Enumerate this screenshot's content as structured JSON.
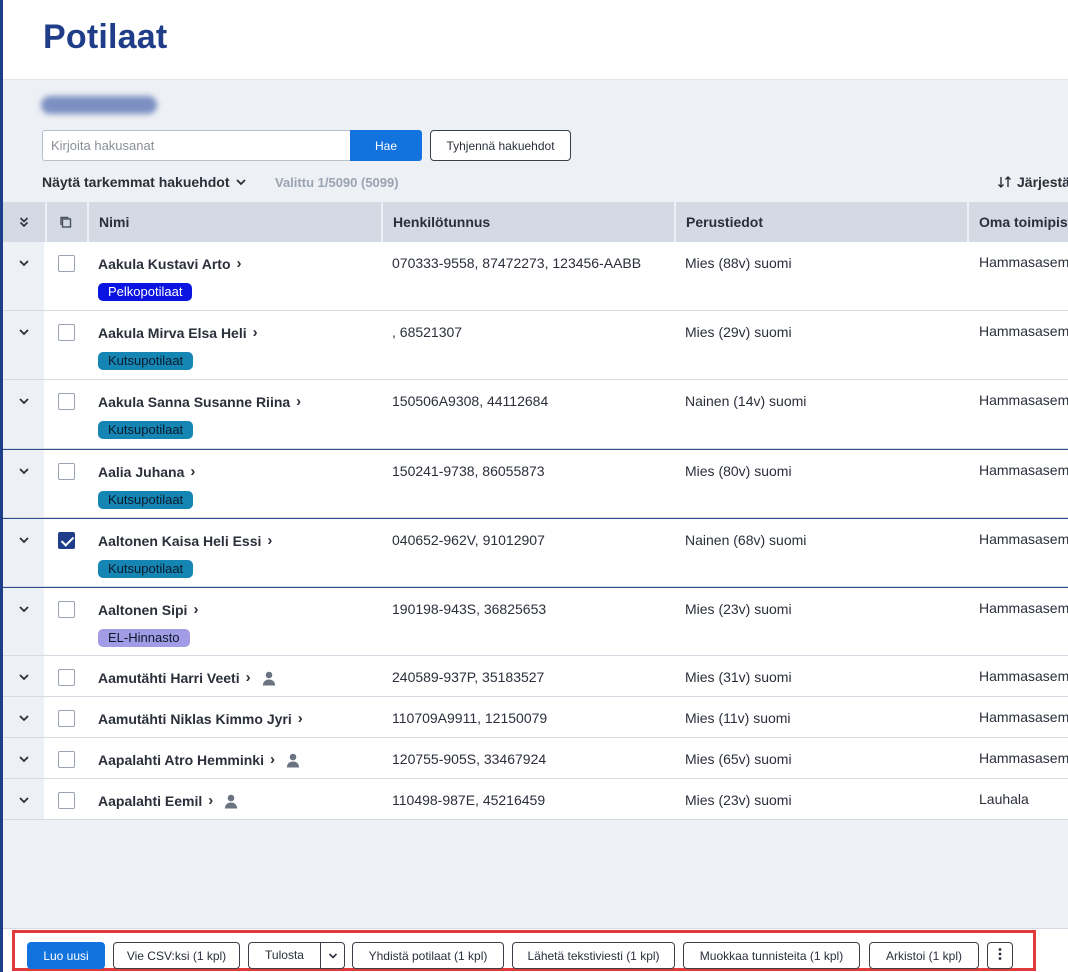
{
  "page": {
    "title": "Potilaat"
  },
  "search": {
    "placeholder": "Kirjoita hakusanat",
    "submit_label": "Hae",
    "clear_label": "Tyhjennä hakuehdot",
    "advanced_label": "Näytä tarkemmat hakuehdot",
    "selected_text": "Valittu 1/5090 (5099)",
    "sort_label": "Järjestä"
  },
  "table": {
    "columns": [
      "Nimi",
      "Henkilötunnus",
      "Perustiedot",
      "Oma toimipiste"
    ],
    "rows": [
      {
        "name": "Aakula Kustavi Arto",
        "tag": "Pelkopotilaat",
        "tag_color": "#0b14e0",
        "tag_text": "#ffffff",
        "id": "070333-9558, 87472273, 123456-AABB",
        "info": "Mies (88v) suomi",
        "office": "Hammasasema",
        "checked": false,
        "person_icon": false
      },
      {
        "name": "Aakula Mirva Elsa Heli",
        "tag": "Kutsupotilaat",
        "tag_color": "#1586b4",
        "tag_text": "#0b1a2a",
        "id": ", 68521307",
        "info": "Mies (29v) suomi",
        "office": "Hammasasema",
        "checked": false,
        "person_icon": false
      },
      {
        "name": "Aakula Sanna Susanne Riina",
        "tag": "Kutsupotilaat",
        "tag_color": "#1586b4",
        "tag_text": "#0b1a2a",
        "id": "150506A9308, 44112684",
        "info": "Nainen (14v) suomi",
        "office": "Hammasasema",
        "checked": false,
        "person_icon": false
      },
      {
        "name": "Aalia Juhana",
        "tag": "Kutsupotilaat",
        "tag_color": "#1586b4",
        "tag_text": "#0b1a2a",
        "id": "150241-9738, 86055873",
        "info": "Mies (80v) suomi",
        "office": "Hammasasema",
        "checked": false,
        "person_icon": false
      },
      {
        "name": "Aaltonen Kaisa Heli Essi",
        "tag": "Kutsupotilaat",
        "tag_color": "#1586b4",
        "tag_text": "#0b1a2a",
        "id": "040652-962V, 91012907",
        "info": "Nainen (68v) suomi",
        "office": "Hammasasema",
        "checked": true,
        "person_icon": false
      },
      {
        "name": "Aaltonen Sipi",
        "tag": "EL-Hinnasto",
        "tag_color": "#a29be6",
        "tag_text": "#0b1a2a",
        "id": "190198-943S, 36825653",
        "info": "Mies (23v) suomi",
        "office": "Hammasasema",
        "checked": false,
        "person_icon": false
      },
      {
        "name": "Aamutähti Harri Veeti",
        "tag": "",
        "id": "240589-937P, 35183527",
        "info": "Mies (31v) suomi",
        "office": "Hammasasema",
        "checked": false,
        "person_icon": true
      },
      {
        "name": "Aamutähti Niklas Kimmo Jyri",
        "tag": "",
        "id": "110709A9911, 12150079",
        "info": "Mies (11v) suomi",
        "office": "Hammasasema",
        "checked": false,
        "person_icon": false
      },
      {
        "name": "Aapalahti Atro Hemminki",
        "tag": "",
        "id": "120755-905S, 33467924",
        "info": "Mies (65v) suomi",
        "office": "Hammasasema",
        "checked": false,
        "person_icon": true
      },
      {
        "name": "Aapalahti Eemil",
        "tag": "",
        "id": "110498-987E, 45216459",
        "info": "Mies (23v) suomi",
        "office": "Lauhala",
        "checked": false,
        "person_icon": true
      }
    ]
  },
  "actions": {
    "create": "Luo uusi",
    "export_csv": "Vie CSV:ksi (1 kpl)",
    "print": "Tulosta",
    "merge": "Yhdistä potilaat (1 kpl)",
    "sms": "Lähetä tekstiviesti (1 kpl)",
    "edit_tags": "Muokkaa tunnisteita (1 kpl)",
    "archive": "Arkistoi (1 kpl)"
  },
  "colors": {
    "accent": "#1273de",
    "title": "#1f3d88",
    "highlight_frame": "#e03a3a"
  }
}
